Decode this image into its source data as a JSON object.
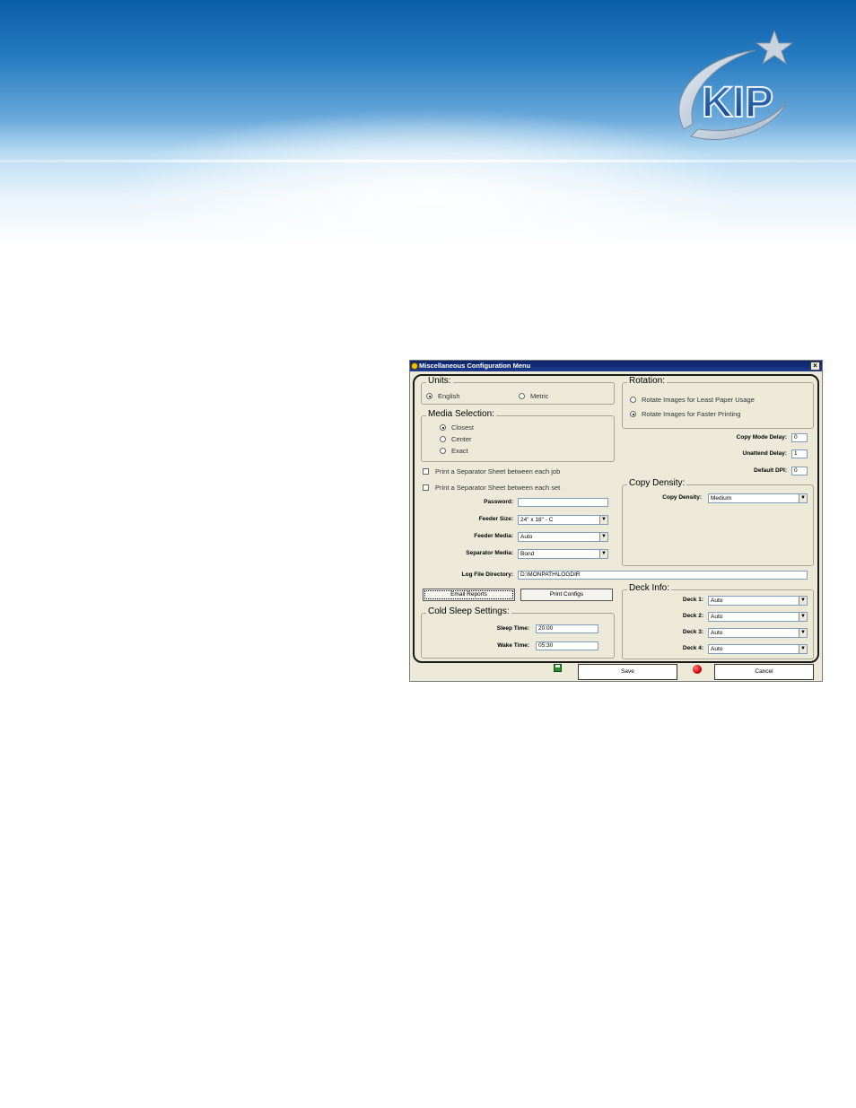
{
  "brand": {
    "logo_text": "KIP"
  },
  "dialog": {
    "title": "Miscellaneous Configuration Menu",
    "close_glyph": "×",
    "units": {
      "legend": "Units:",
      "options": [
        "English",
        "Metric"
      ],
      "selected": "English"
    },
    "media_selection": {
      "legend": "Media Selection:",
      "options": [
        "Closest",
        "Center",
        "Exact"
      ],
      "selected": "Closest"
    },
    "separator_job": "Print a Separator Sheet between each job",
    "separator_set": "Print a Separator Sheet between each set",
    "password": {
      "label": "Password:",
      "value": ""
    },
    "feeder_size": {
      "label": "Feeder Size:",
      "value": "24\" x 18\"  - C"
    },
    "feeder_media": {
      "label": "Feeder Media:",
      "value": "Auto"
    },
    "separator_media": {
      "label": "Separator Media:",
      "value": "Bond"
    },
    "log_dir": {
      "label": "Log File Directory:",
      "value": "D:\\MONPATH\\LOGDIR"
    },
    "email_reports": "Email Reports",
    "print_configs": "Print Configs",
    "cold_sleep": {
      "legend": "Cold Sleep Settings:",
      "sleep_label": "Sleep Time:",
      "sleep_value": "20:00",
      "wake_label": "Wake Time:",
      "wake_value": "05:30"
    },
    "rotation": {
      "legend": "Rotation:",
      "options": [
        "Rotate Images for Least Paper Usage",
        "Rotate Images for Faster Printing"
      ],
      "selected": "Rotate Images for Faster Printing"
    },
    "copy_mode_delay": {
      "label": "Copy Mode Delay:",
      "value": "0"
    },
    "unattend_delay": {
      "label": "Unattend Delay:",
      "value": "1"
    },
    "default_dpi": {
      "label": "Default DPI:",
      "value": "0"
    },
    "copy_density": {
      "legend": "Copy Density:",
      "label": "Copy Density:",
      "value": "Medium"
    },
    "deck_info": {
      "legend": "Deck Info:",
      "decks": [
        {
          "label": "Deck 1:",
          "value": "Auto"
        },
        {
          "label": "Deck 2:",
          "value": "Auto"
        },
        {
          "label": "Deck 3:",
          "value": "Auto"
        },
        {
          "label": "Deck 4:",
          "value": "Auto"
        }
      ]
    },
    "save": "Save",
    "cancel": "Cancel"
  },
  "colors": {
    "titlebar": "#0a246a",
    "dialog_bg": "#ece9d8",
    "banner_blue": "#0b5ea8"
  }
}
